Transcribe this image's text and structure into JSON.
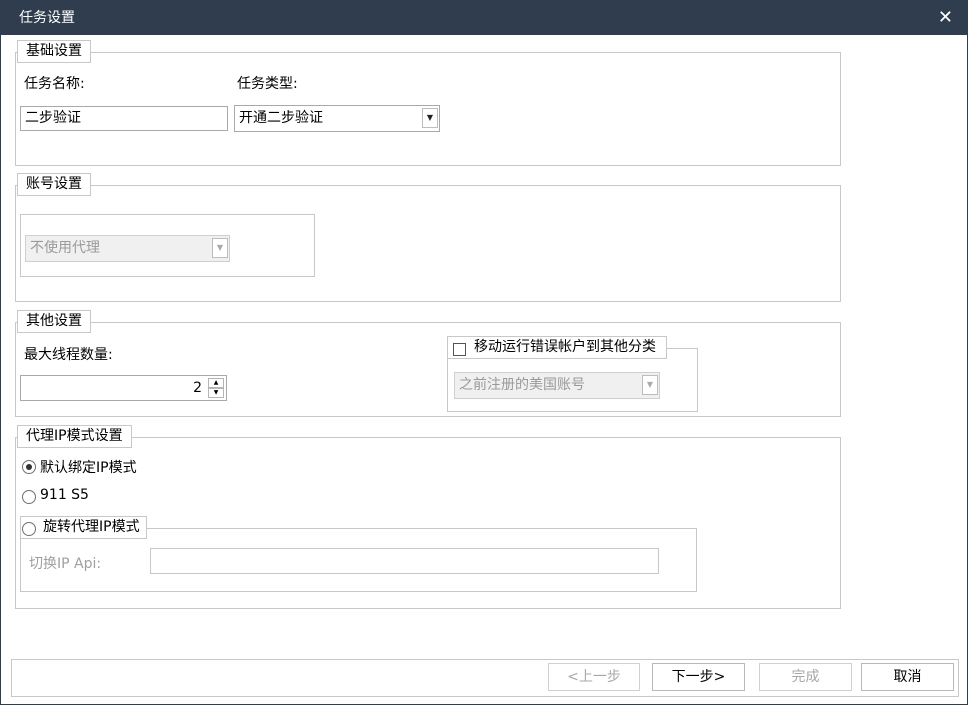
{
  "window": {
    "title": "任务设置",
    "close_glyph": "✕"
  },
  "basic": {
    "legend": "基础设置",
    "task_name_label": "任务名称:",
    "task_type_label": "任务类型:",
    "task_name_value": "二步验证",
    "task_type_value": "开通二步验证"
  },
  "account": {
    "legend": "账号设置",
    "proxy_value": "不使用代理"
  },
  "other": {
    "legend": "其他设置",
    "max_threads_label": "最大线程数量:",
    "max_threads_value": "2",
    "move_checkbox_label": "移动运行错误帐户到其他分类",
    "move_checkbox_checked": false,
    "category_value": "之前注册的美国账号"
  },
  "proxy_mode": {
    "legend": "代理IP模式设置",
    "options": [
      {
        "label": "默认绑定IP模式",
        "selected": true
      },
      {
        "label": "911 S5",
        "selected": false
      },
      {
        "label": "旋转代理IP模式",
        "selected": false
      }
    ],
    "api_label": "切换IP Api:",
    "api_value": ""
  },
  "buttons": {
    "prev": "<上一步",
    "next": "下一步>",
    "finish": "完成",
    "cancel": "取消"
  }
}
